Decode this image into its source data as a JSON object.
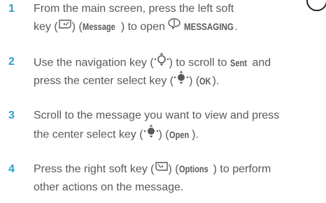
{
  "steps": [
    {
      "number": "1",
      "lines": [
        {
          "text": "From the main screen, press the left soft"
        },
        {
          "t1": "key (",
          "t2": ") (",
          "label": "Message",
          "t3": ") to open ",
          "menu": "MESSAGING",
          "t4": "."
        }
      ]
    },
    {
      "number": "2",
      "lines": [
        {
          "t1": "Use the navigation key (",
          "t2": ") to scroll to ",
          "label": "Sent",
          "t3": " and"
        },
        {
          "t1": "press the center select key (",
          "t2": ") (",
          "label": "OK",
          "t3": ")."
        }
      ]
    },
    {
      "number": "3",
      "lines": [
        {
          "text": "Scroll to the message you want to view and press"
        },
        {
          "t1": "the center select key (",
          "t2": ") (",
          "label": "Open",
          "t3": ")."
        }
      ]
    },
    {
      "number": "4",
      "lines": [
        {
          "t1": "Press the right soft key (",
          "t2": ") (",
          "label": "Options",
          "t3": ") to perform"
        },
        {
          "text": "other actions on the message."
        }
      ]
    }
  ],
  "icons": {
    "left_soft_key": "left-soft-key-icon",
    "messaging": "messaging-icon",
    "navigation_key": "navigation-key-icon",
    "center_select_key": "center-select-key-icon",
    "right_soft_key": "right-soft-key-icon"
  },
  "colors": {
    "step_number": "#2aa0cf",
    "body_text": "#58595b"
  }
}
